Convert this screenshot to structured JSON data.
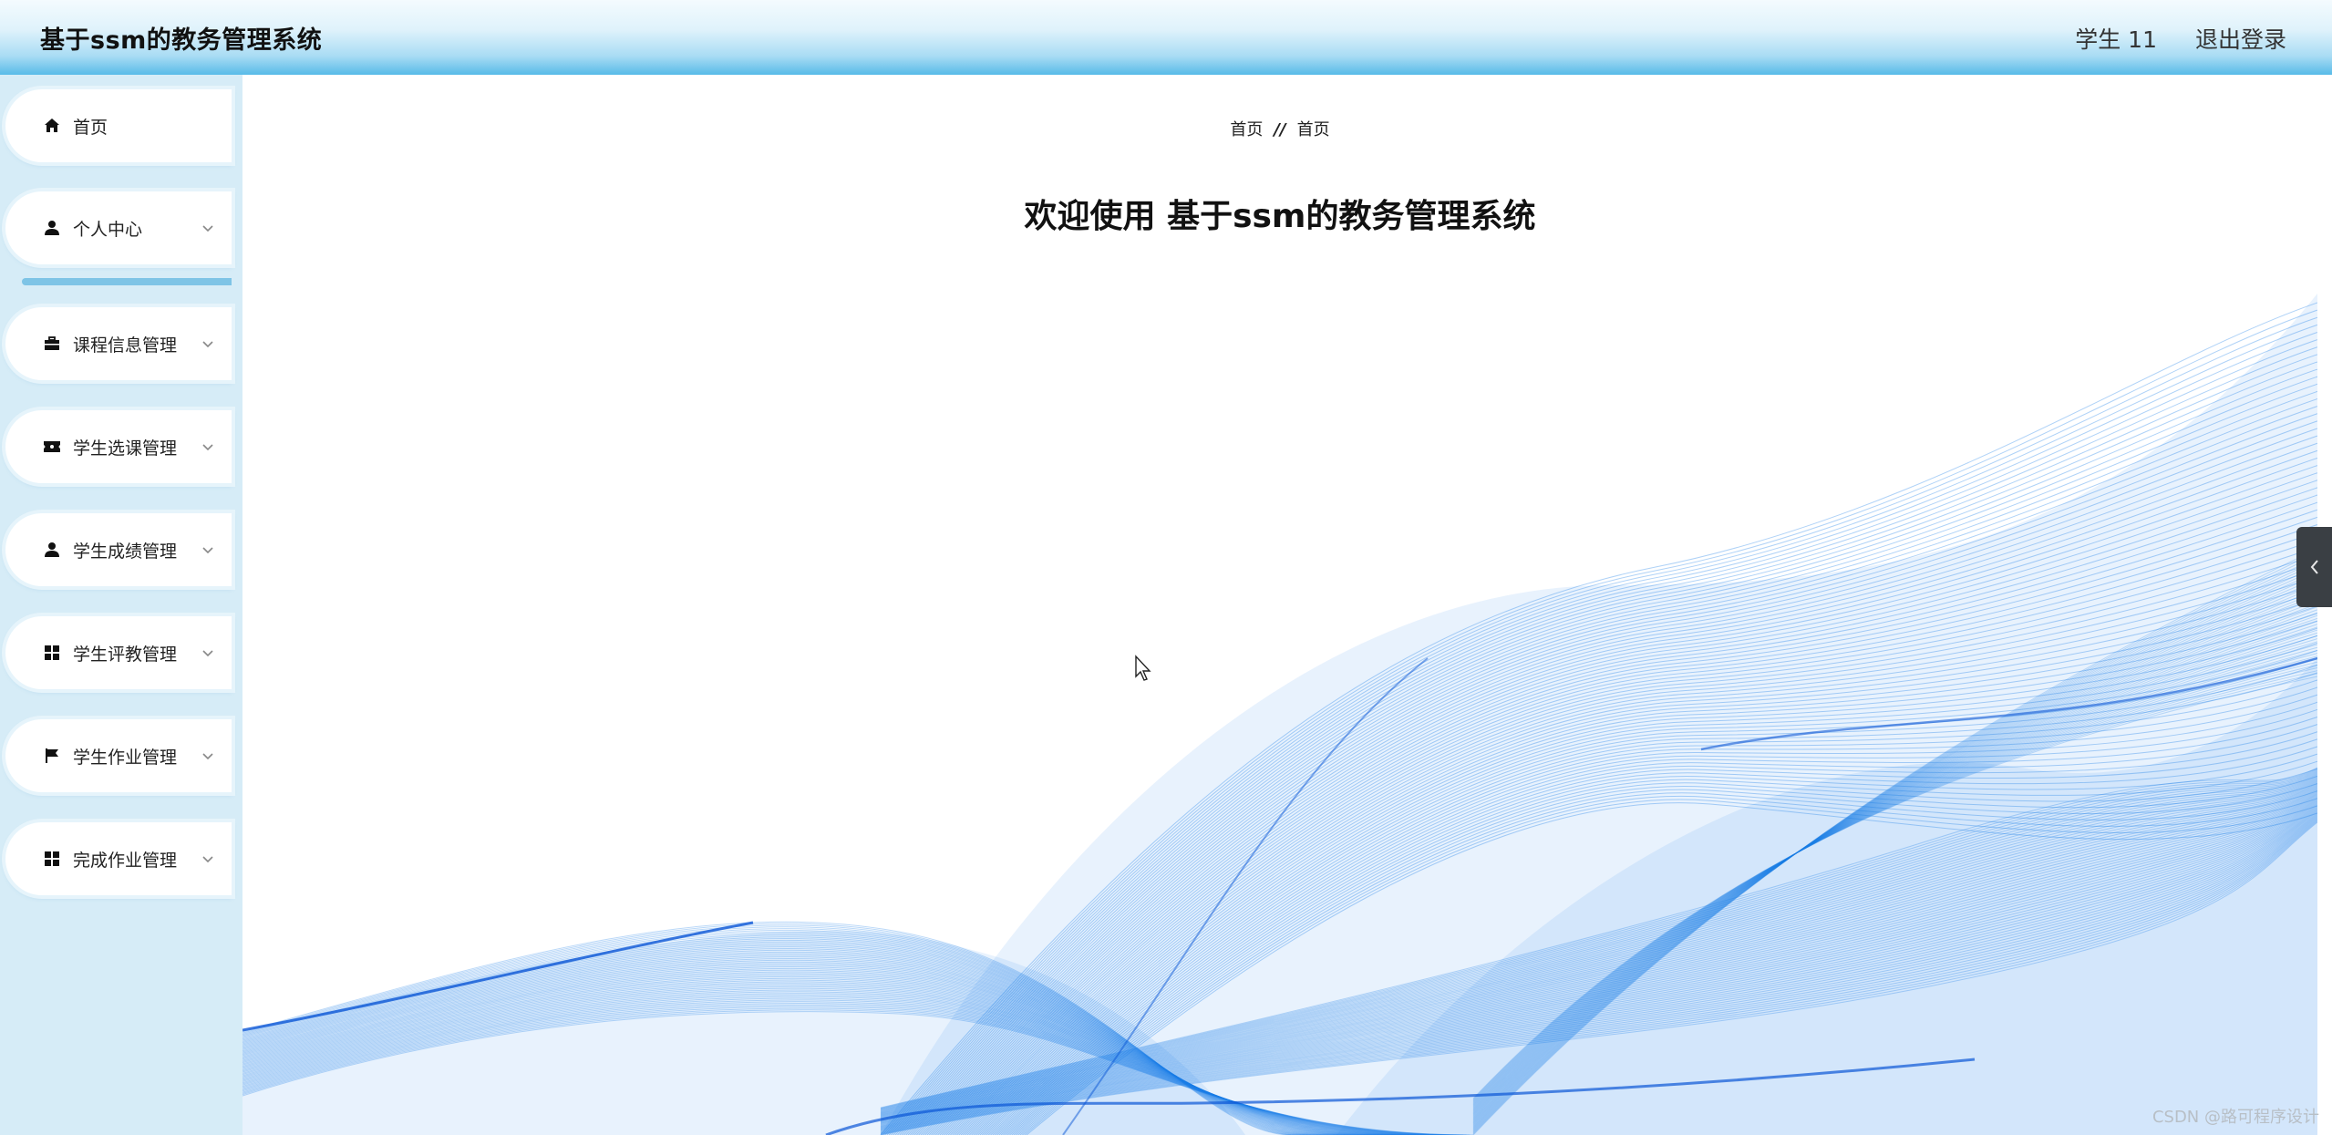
{
  "header": {
    "title": "基于ssm的教务管理系统",
    "user": "学生 11",
    "logout": "退出登录"
  },
  "sidebar": {
    "items": [
      {
        "label": "首页",
        "icon": "home-icon"
      },
      {
        "label": "个人中心",
        "icon": "user-icon"
      },
      {
        "label": "课程信息管理",
        "icon": "briefcase-icon"
      },
      {
        "label": "学生选课管理",
        "icon": "ticket-icon"
      },
      {
        "label": "学生成绩管理",
        "icon": "user-icon"
      },
      {
        "label": "学生评教管理",
        "icon": "grid-icon"
      },
      {
        "label": "学生作业管理",
        "icon": "flag-icon"
      },
      {
        "label": "完成作业管理",
        "icon": "grid-icon"
      }
    ]
  },
  "main": {
    "breadcrumb": [
      "首页",
      "//",
      "首页"
    ],
    "welcome": "欢迎使用 基于ssm的教务管理系统"
  },
  "watermark": "CSDN @路可程序设计",
  "colors": {
    "header_gradient_bottom": "#58bbe8",
    "sidebar_bg": "#d6ecf7",
    "wave_blue": "#1a7fe8"
  }
}
